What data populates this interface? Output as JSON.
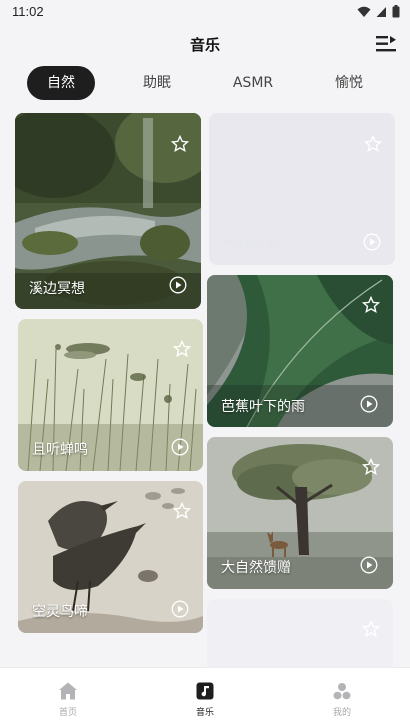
{
  "status_bar": {
    "time": "11:02"
  },
  "header": {
    "title": "音乐"
  },
  "tabs": [
    {
      "label": "自然",
      "active": true
    },
    {
      "label": "助眠",
      "active": false
    },
    {
      "label": "ASMR",
      "active": false
    },
    {
      "label": "愉悦",
      "active": false
    }
  ],
  "cards": [
    {
      "title": "溪边冥想",
      "icon_fav": "star-outline-icon",
      "icon_play": "play-circle-icon"
    },
    {
      "title": "竹林听雨",
      "icon_fav": "star-outline-icon",
      "icon_play": "play-circle-icon"
    },
    {
      "title": "芭蕉叶下的雨",
      "icon_fav": "star-outline-icon",
      "icon_play": "play-circle-icon"
    },
    {
      "title": "且听蝉鸣",
      "icon_fav": "star-outline-icon",
      "icon_play": "play-circle-icon"
    },
    {
      "title": "大自然馈赠",
      "icon_fav": "star-outline-icon",
      "icon_play": "play-circle-icon"
    },
    {
      "title": "空灵鸟啼",
      "icon_fav": "star-outline-icon",
      "icon_play": "play-circle-icon"
    }
  ],
  "bottom_nav": [
    {
      "label": "首页",
      "icon": "home-icon",
      "active": false
    },
    {
      "label": "音乐",
      "icon": "music-note-icon",
      "active": true
    },
    {
      "label": "我的",
      "icon": "profile-icon",
      "active": false
    }
  ],
  "colors": {
    "active_tab_bg": "#1e1e1e",
    "background": "#f4f4f6",
    "nav_inactive": "#aaaaaa"
  }
}
